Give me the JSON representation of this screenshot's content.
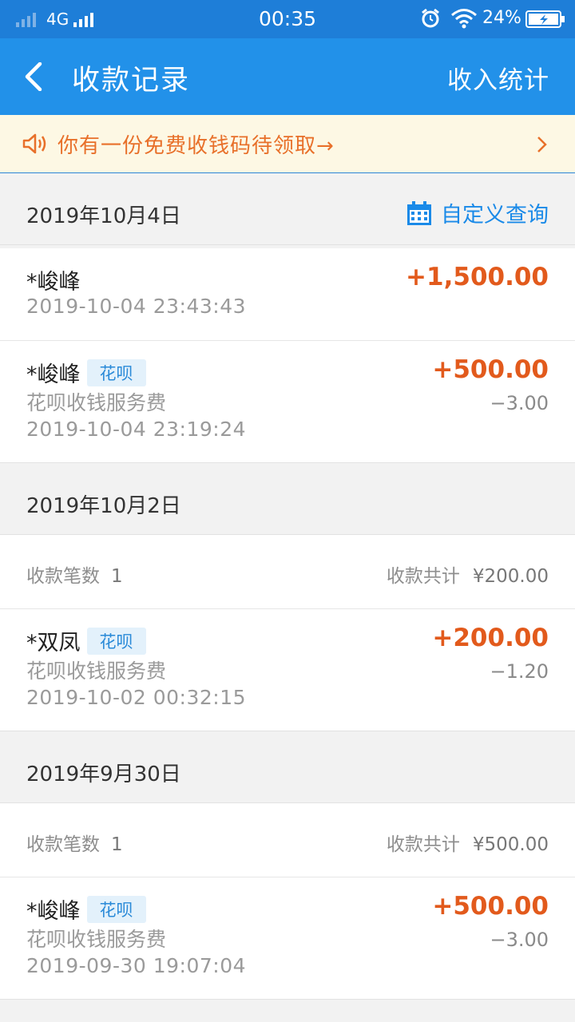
{
  "status_bar": {
    "network": "4G",
    "time": "00:35",
    "battery": "24%"
  },
  "nav": {
    "title": "收款记录",
    "right_action": "收入统计"
  },
  "notice": {
    "text": "你有一份免费收钱码待领取→"
  },
  "custom_query_label": "自定义查询",
  "groups": [
    {
      "date": "2019年10月4日",
      "records": [
        {
          "name": "*峻峰",
          "amount": "+1,500.00",
          "time": "2019-10-04 23:43:43"
        },
        {
          "name": "*峻峰",
          "tag": "花呗",
          "amount": "+500.00",
          "desc": "花呗收钱服务费",
          "fee": "−3.00",
          "time": "2019-10-04 23:19:24"
        }
      ]
    },
    {
      "date": "2019年10月2日",
      "summary": {
        "count_label": "收款笔数",
        "count": "1",
        "total_label": "收款共计",
        "total": "¥200.00"
      },
      "records": [
        {
          "name": "*双凤",
          "tag": "花呗",
          "amount": "+200.00",
          "desc": "花呗收钱服务费",
          "fee": "−1.20",
          "time": "2019-10-02 00:32:15"
        }
      ]
    },
    {
      "date": "2019年9月30日",
      "summary": {
        "count_label": "收款笔数",
        "count": "1",
        "total_label": "收款共计",
        "total": "¥500.00"
      },
      "records": [
        {
          "name": "*峻峰",
          "tag": "花呗",
          "amount": "+500.00",
          "desc": "花呗收钱服务费",
          "fee": "−3.00",
          "time": "2019-09-30 19:07:04"
        }
      ]
    }
  ],
  "colors": {
    "status_bar": "#1e7ed8",
    "nav_bar": "#2291e9",
    "amount": "#e25a1c",
    "notice_text": "#e8702a",
    "link": "#1a8ae8"
  }
}
